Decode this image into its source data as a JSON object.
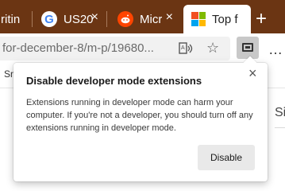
{
  "tabs": [
    {
      "label": "ritin",
      "icon": "notion-icon",
      "active": false
    },
    {
      "label": "US20",
      "icon": "google-icon",
      "active": false
    },
    {
      "label": "Micr",
      "icon": "reddit-icon",
      "active": false
    },
    {
      "label": "Top f",
      "icon": "microsoft-icon",
      "active": true
    }
  ],
  "tab_close": "×",
  "new_tab": "+",
  "google_glyph": "G",
  "toolbar": {
    "url": "for-december-8/m-p/19680...",
    "favorite_icon": "☆",
    "more_icon": "…"
  },
  "page": {
    "bookmark_fragment": "Sn",
    "side_text": "Si"
  },
  "popup": {
    "title": "Disable developer mode extensions",
    "close": "×",
    "body": "Extensions running in developer mode can harm your computer. If you're not a developer, you should turn off any extensions running in developer mode.",
    "button": "Disable"
  },
  "colors": {
    "tab_strip": "#6b3513",
    "reddit": "#ff4500",
    "microsoft": [
      "#f25022",
      "#7fba00",
      "#00a4ef",
      "#ffb900"
    ]
  }
}
